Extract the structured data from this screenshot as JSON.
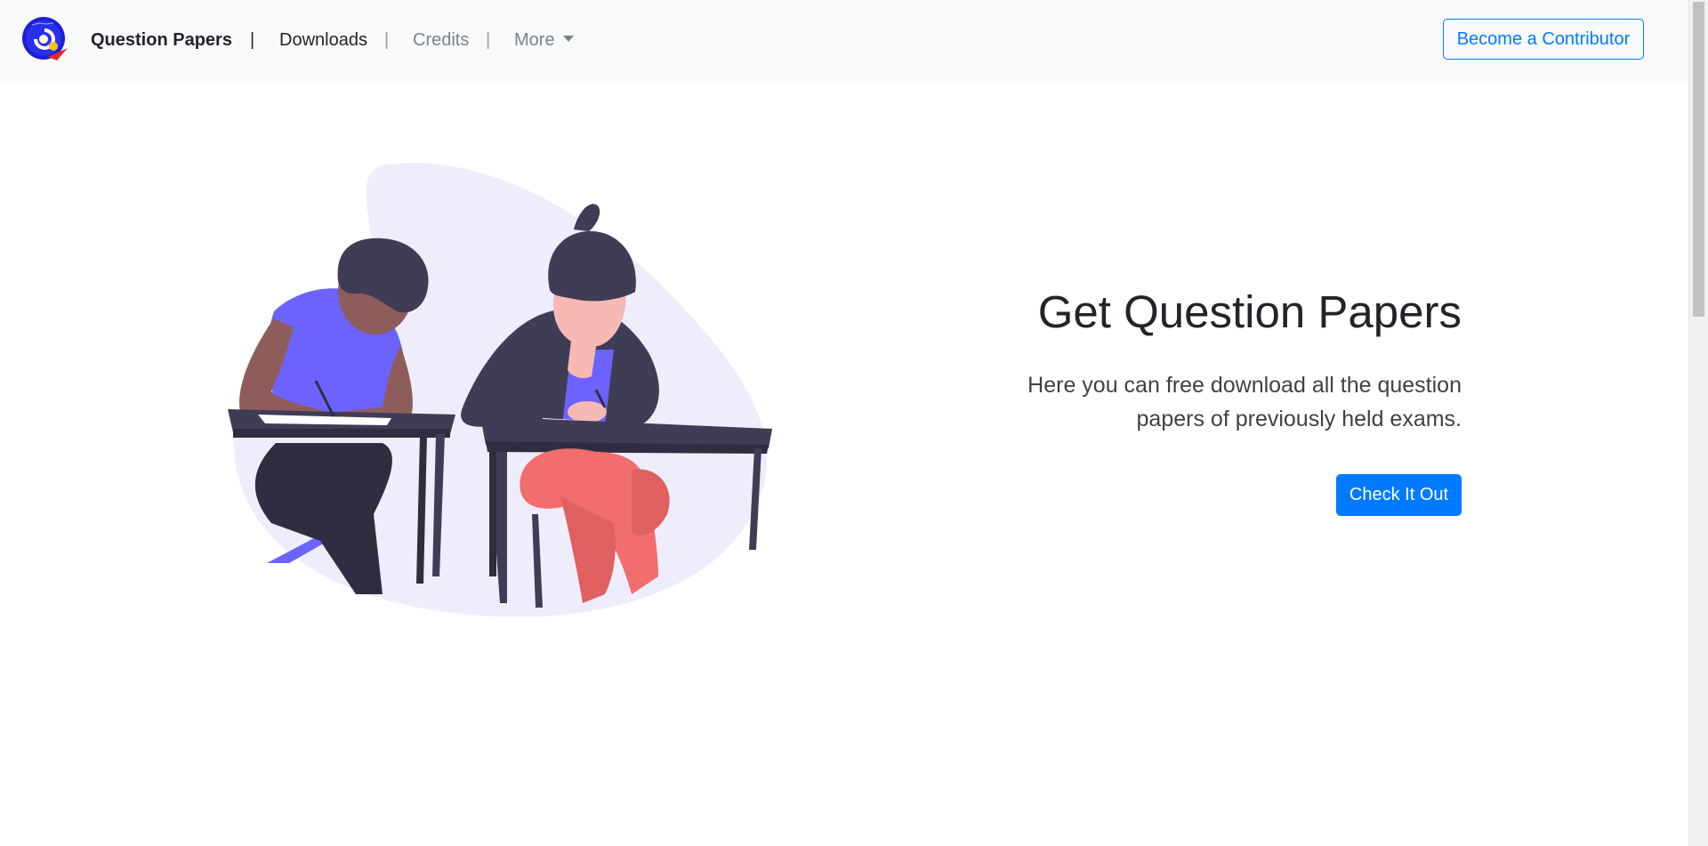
{
  "navbar": {
    "brand": "Question Papers",
    "separator": "|",
    "links": {
      "downloads": "Downloads",
      "credits": "Credits",
      "more": "More"
    },
    "contributor_button": "Become a Contributor"
  },
  "hero": {
    "title": "Get Question Papers",
    "description": "Here you can free download all the question papers of previously held exams.",
    "cta_button": "Check It Out",
    "illustration": "students-writing-exam-illustration"
  },
  "colors": {
    "primary": "#007bff",
    "navbar_bg": "#f8f9fa",
    "text_dark": "#212529",
    "text_muted": "#7c8289",
    "illustration_purple": "#6c63ff",
    "illustration_coral": "#f26d6d",
    "illustration_dark": "#3f3d56"
  },
  "icons": {
    "logo": "site-logo-icon",
    "dropdown": "caret-down-icon"
  }
}
